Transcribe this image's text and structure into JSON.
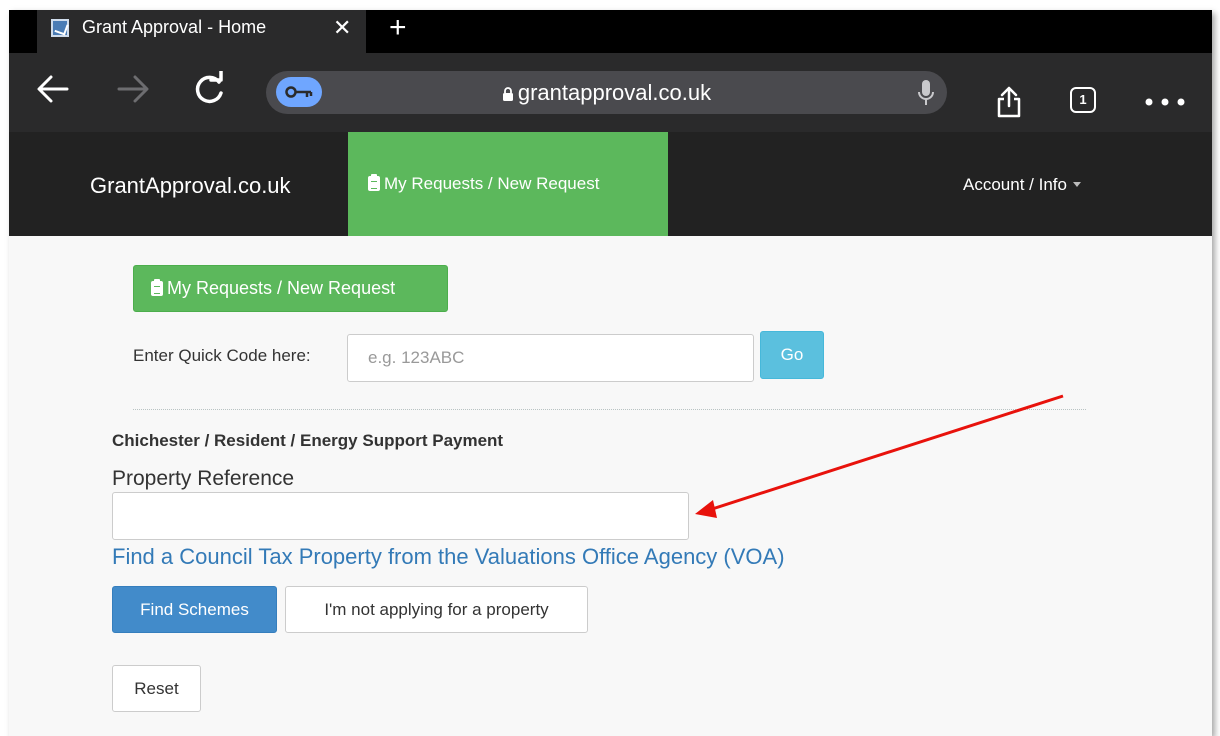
{
  "browser": {
    "tab_title": "Grant Approval - Home",
    "tab_close": "✕",
    "new_tab": "+",
    "url": "grantapproval.co.uk",
    "tab_count": "1"
  },
  "navbar": {
    "brand": "GrantApproval.co.uk",
    "active_item": "My Requests / New Request",
    "account": "Account / Info"
  },
  "content": {
    "requests_button": "My Requests / New Request",
    "quick_code_label": "Enter Quick Code here:",
    "quick_code_placeholder": "e.g. 123ABC",
    "go_button": "Go",
    "scheme_title": "Chichester / Resident / Energy Support Payment",
    "property_label": "Property Reference",
    "property_value": "",
    "voa_link": "Find a Council Tax Property from the Valuations Office Agency (VOA)",
    "find_button": "Find Schemes",
    "not_property_button": "I'm not applying for a property",
    "reset_button": "Reset"
  },
  "colors": {
    "nav_active": "#5cb85c",
    "navbar_bg": "#222222",
    "primary": "#428bca",
    "info": "#5bc0de",
    "link": "#337ab7",
    "annotation_arrow": "#e8120c"
  }
}
